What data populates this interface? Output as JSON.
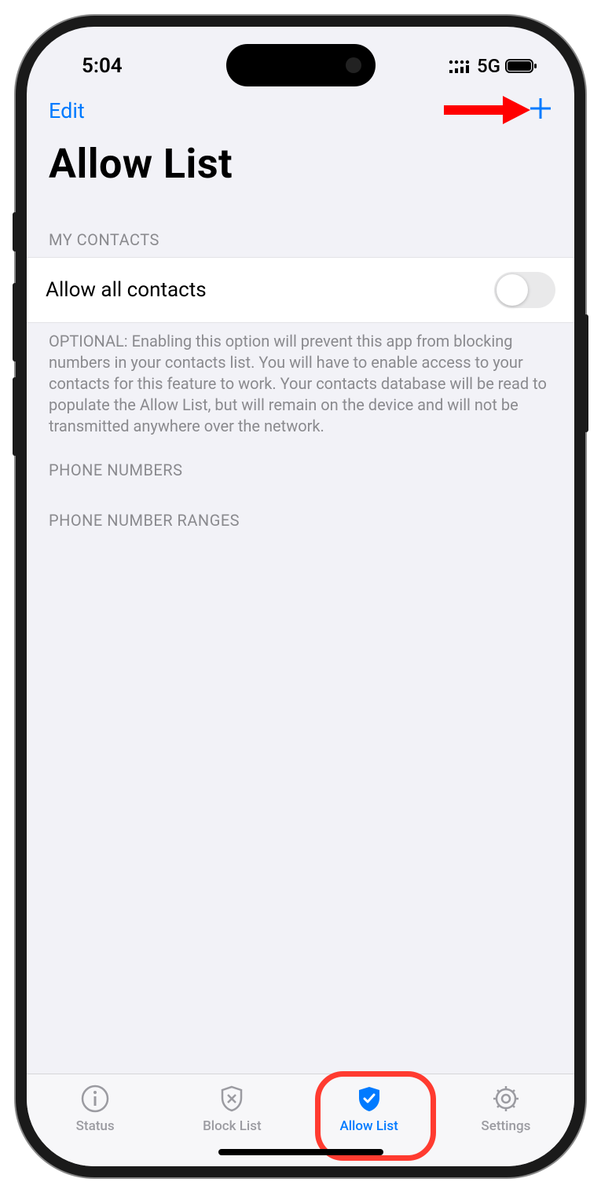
{
  "status_bar": {
    "time": "5:04",
    "network_label": "5G"
  },
  "nav": {
    "edit_label": "Edit",
    "add_label": "+"
  },
  "page_title": "Allow List",
  "sections": {
    "contacts_header": "MY CONTACTS",
    "contacts_row_label": "Allow all contacts",
    "contacts_toggle_on": false,
    "contacts_footer": "OPTIONAL: Enabling this option will prevent this app from blocking numbers in your contacts list. You will have to enable access to your contacts for this feature to work. Your contacts database will be read to populate the Allow List, but will remain on the device and will not be transmitted anywhere over the network.",
    "numbers_header": "PHONE NUMBERS",
    "ranges_header": "PHONE NUMBER RANGES"
  },
  "tabs": [
    {
      "id": "status",
      "label": "Status",
      "active": false
    },
    {
      "id": "blocklist",
      "label": "Block List",
      "active": false
    },
    {
      "id": "allowlist",
      "label": "Allow List",
      "active": true
    },
    {
      "id": "settings",
      "label": "Settings",
      "active": false
    }
  ],
  "annotations": {
    "arrow_points_to": "add-button",
    "circle_highlights": "tab-allow-list"
  },
  "colors": {
    "accent": "#007aff",
    "annotation": "#ff3b30",
    "background": "#f2f2f7",
    "secondary_text": "#8a8a8e"
  }
}
